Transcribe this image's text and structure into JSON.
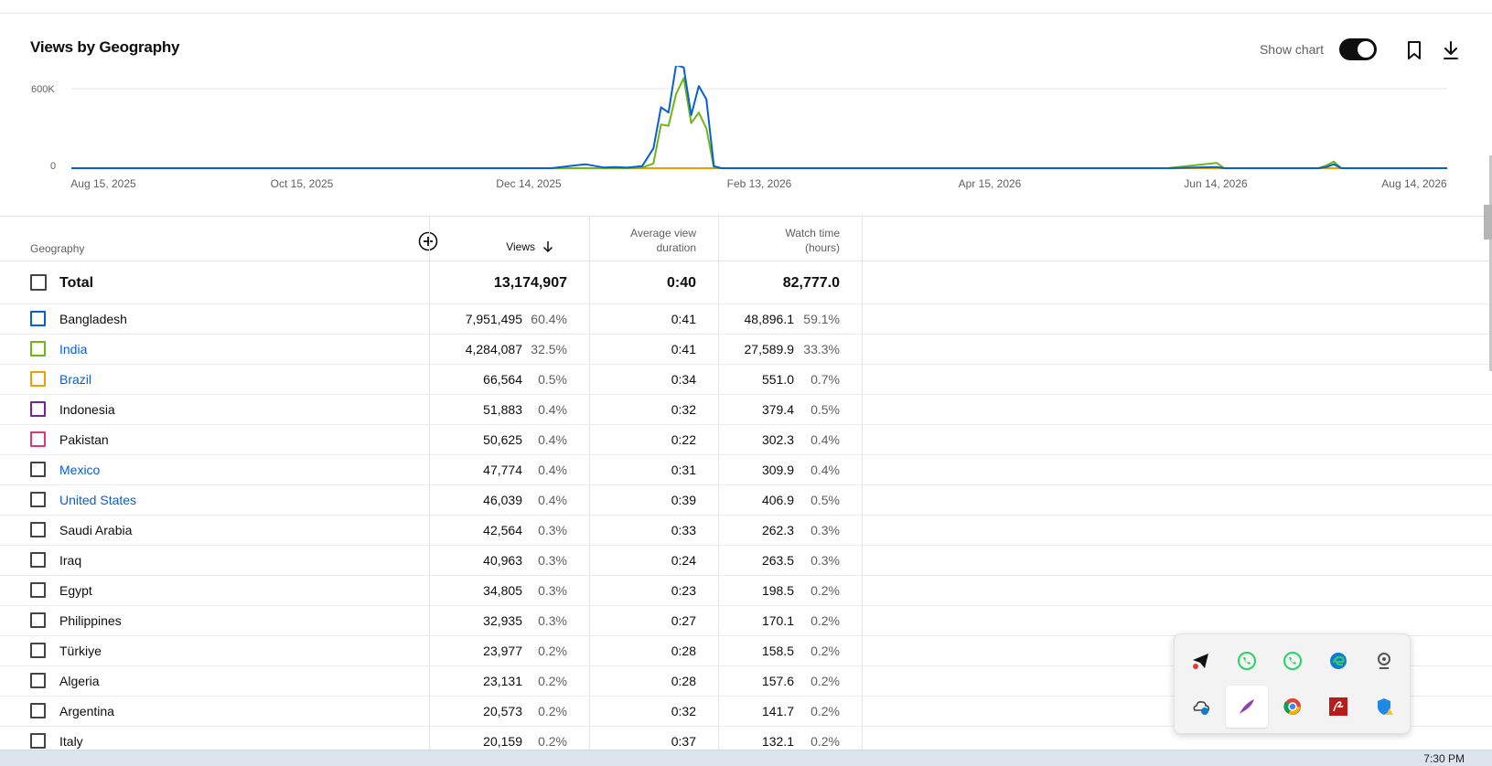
{
  "card": {
    "title": "Views by Geography",
    "show_chart_label": "Show chart",
    "show_chart_on": true
  },
  "chart_data": {
    "type": "line",
    "x_ticks": [
      "Aug 15, 2025",
      "Oct 15, 2025",
      "Dec 14, 2025",
      "Feb 13, 2026",
      "Apr 15, 2026",
      "Jun 14, 2026",
      "Aug 14, 2026"
    ],
    "y_ticks": [
      "600K",
      "0"
    ],
    "ylim": [
      0,
      760000
    ],
    "grid": true,
    "x_dates": [
      "2025-08-15",
      "2025-12-20",
      "2025-12-29",
      "2026-01-03",
      "2026-01-06",
      "2026-01-09",
      "2026-01-13",
      "2026-01-16",
      "2026-01-18",
      "2026-01-20",
      "2026-01-22",
      "2026-01-24",
      "2026-01-26",
      "2026-01-28",
      "2026-01-30",
      "2026-02-01",
      "2026-02-03",
      "2026-02-05",
      "2026-06-01",
      "2026-06-14",
      "2026-06-16",
      "2026-07-11",
      "2026-07-13",
      "2026-07-15",
      "2026-07-17",
      "2026-08-14"
    ],
    "series": [
      {
        "color": "#065fd4",
        "values": [
          0,
          0,
          30000,
          5000,
          8000,
          4000,
          15000,
          150000,
          460000,
          420000,
          780000,
          760000,
          400000,
          620000,
          520000,
          15000,
          0,
          0,
          0,
          8000,
          0,
          0,
          8000,
          30000,
          0,
          0
        ]
      },
      {
        "color": "#70b616",
        "values": [
          0,
          0,
          0,
          0,
          0,
          0,
          5000,
          35000,
          330000,
          320000,
          560000,
          680000,
          340000,
          420000,
          300000,
          4000,
          0,
          0,
          0,
          40000,
          0,
          0,
          20000,
          50000,
          0,
          0
        ]
      },
      {
        "color": "#f29d00",
        "values": [
          0,
          0,
          0,
          0,
          0,
          0,
          0,
          0,
          0,
          0,
          0,
          0,
          0,
          0,
          0,
          0,
          0,
          0,
          0,
          0,
          0,
          0,
          0,
          0,
          0,
          0
        ]
      }
    ]
  },
  "table": {
    "headers": {
      "geography": "Geography",
      "views": "Views",
      "avd_line1": "Average view",
      "avd_line2": "duration",
      "wt_line1": "Watch time",
      "wt_line2": "(hours)"
    },
    "total": {
      "label": "Total",
      "views": "13,174,907",
      "avd": "0:40",
      "watch_time": "82,777.0"
    },
    "rows": [
      {
        "name": "Bangladesh",
        "link": false,
        "color": "#065fd4",
        "views": "7,951,495",
        "views_pct": "60.4%",
        "avd": "0:41",
        "wt": "48,896.1",
        "wt_pct": "59.1%"
      },
      {
        "name": "India",
        "link": true,
        "color": "#70b616",
        "views": "4,284,087",
        "views_pct": "32.5%",
        "avd": "0:41",
        "wt": "27,589.9",
        "wt_pct": "33.3%"
      },
      {
        "name": "Brazil",
        "link": true,
        "color": "#f29d00",
        "views": "66,564",
        "views_pct": "0.5%",
        "avd": "0:34",
        "wt": "551.0",
        "wt_pct": "0.7%"
      },
      {
        "name": "Indonesia",
        "link": false,
        "color": "#7b1fa2",
        "views": "51,883",
        "views_pct": "0.4%",
        "avd": "0:32",
        "wt": "379.4",
        "wt_pct": "0.5%"
      },
      {
        "name": "Pakistan",
        "link": false,
        "color": "#e0386c",
        "views": "50,625",
        "views_pct": "0.4%",
        "avd": "0:22",
        "wt": "302.3",
        "wt_pct": "0.4%"
      },
      {
        "name": "Mexico",
        "link": true,
        "color": "#444444",
        "views": "47,774",
        "views_pct": "0.4%",
        "avd": "0:31",
        "wt": "309.9",
        "wt_pct": "0.4%"
      },
      {
        "name": "United States",
        "link": true,
        "color": "#444444",
        "views": "46,039",
        "views_pct": "0.4%",
        "avd": "0:39",
        "wt": "406.9",
        "wt_pct": "0.5%"
      },
      {
        "name": "Saudi Arabia",
        "link": false,
        "color": "#444444",
        "views": "42,564",
        "views_pct": "0.3%",
        "avd": "0:33",
        "wt": "262.3",
        "wt_pct": "0.3%"
      },
      {
        "name": "Iraq",
        "link": false,
        "color": "#444444",
        "views": "40,963",
        "views_pct": "0.3%",
        "avd": "0:24",
        "wt": "263.5",
        "wt_pct": "0.3%"
      },
      {
        "name": "Egypt",
        "link": false,
        "color": "#444444",
        "views": "34,805",
        "views_pct": "0.3%",
        "avd": "0:23",
        "wt": "198.5",
        "wt_pct": "0.2%"
      },
      {
        "name": "Philippines",
        "link": false,
        "color": "#444444",
        "views": "32,935",
        "views_pct": "0.3%",
        "avd": "0:27",
        "wt": "170.1",
        "wt_pct": "0.2%"
      },
      {
        "name": "Türkiye",
        "link": false,
        "color": "#444444",
        "views": "23,977",
        "views_pct": "0.2%",
        "avd": "0:28",
        "wt": "158.5",
        "wt_pct": "0.2%"
      },
      {
        "name": "Algeria",
        "link": false,
        "color": "#444444",
        "views": "23,131",
        "views_pct": "0.2%",
        "avd": "0:28",
        "wt": "157.6",
        "wt_pct": "0.2%"
      },
      {
        "name": "Argentina",
        "link": false,
        "color": "#444444",
        "views": "20,573",
        "views_pct": "0.2%",
        "avd": "0:32",
        "wt": "141.7",
        "wt_pct": "0.2%"
      },
      {
        "name": "Italy",
        "link": false,
        "color": "#444444",
        "views": "20,159",
        "views_pct": "0.2%",
        "avd": "0:37",
        "wt": "132.1",
        "wt_pct": "0.2%"
      }
    ]
  },
  "tray": {
    "icons": [
      "telegram-icon",
      "whatsapp-icon",
      "whatsapp-icon",
      "edge-icon",
      "webcam-icon",
      "onedrive-icon",
      "feather-pen-icon",
      "chrome-icon",
      "pdf-reader-icon",
      "windows-security-icon"
    ],
    "selected_index": 6
  },
  "taskbar": {
    "clock": "7:30 PM"
  }
}
